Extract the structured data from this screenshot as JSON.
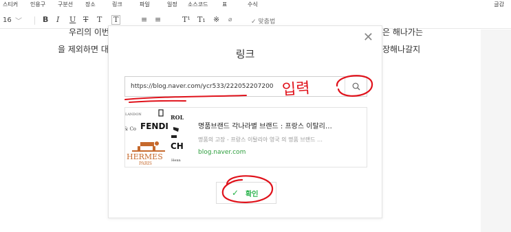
{
  "menubar": {
    "items": [
      "스티커",
      "인용구",
      "구분선",
      "장소",
      "링크",
      "파일",
      "일정",
      "소스코드",
      "표",
      "수식"
    ],
    "right_label": "글감"
  },
  "toolbar": {
    "font_size": "16",
    "buttons": {
      "bold": "B",
      "italic": "I",
      "underline": "U",
      "strike": "T",
      "text_color": "T",
      "bg_color": "T",
      "align_left": "≡",
      "align_center": "≡",
      "superscript": "T¹",
      "subscript": "T₁",
      "special_char": "※",
      "link": "🔗",
      "spellcheck": "✓ 맞춤법"
    }
  },
  "doc": {
    "line1_left": "우리의 이번",
    "line1_right": "은 해나가는",
    "line2_left": "을 제외하면 대",
    "line2_right": "장해나갈지"
  },
  "modal": {
    "title": "링크",
    "url_value": "https://blog.naver.com/ycr533/222052207200",
    "preview": {
      "title": "명품브랜드 각나라별 브랜드 : 프랑스 이탈리…",
      "description": "명품의 고장 - 프랑스 이탈리아 영국 의 명품 브랜드 …",
      "domain": "blog.naver.com",
      "thumb_labels": {
        "landon": "LANDON",
        "fendi": "FENDI",
        "co": "& Co",
        "rol": "ROL",
        "ch": "CH",
        "hermes": "HERMES",
        "paris": "PARIS",
        "henn": "Henn"
      }
    },
    "confirm_label": "확인"
  },
  "annotation": {
    "handwritten_text": "입력",
    "color": "#e0121b"
  },
  "colors": {
    "accent_green": "#27b24a",
    "domain_green": "#2a9d3a"
  }
}
